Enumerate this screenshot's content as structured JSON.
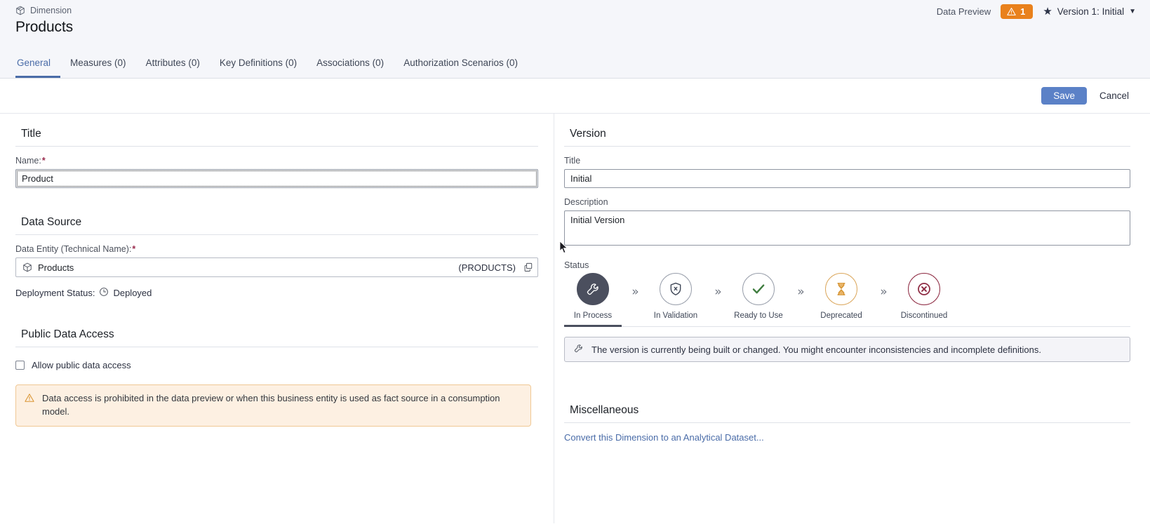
{
  "header": {
    "breadcrumb": "Dimension",
    "title": "Products",
    "data_preview": "Data Preview",
    "warning_count": "1",
    "version_switch": "Version 1: Initial"
  },
  "tabs": [
    {
      "label": "General",
      "active": true
    },
    {
      "label": "Measures (0)",
      "active": false
    },
    {
      "label": "Attributes (0)",
      "active": false
    },
    {
      "label": "Key Definitions (0)",
      "active": false
    },
    {
      "label": "Associations (0)",
      "active": false
    },
    {
      "label": "Authorization Scenarios (0)",
      "active": false
    }
  ],
  "actions": {
    "save": "Save",
    "cancel": "Cancel"
  },
  "left": {
    "title_section": "Title",
    "name_label": "Name:",
    "name_value": "Product",
    "data_source_section": "Data Source",
    "data_entity_label": "Data Entity (Technical Name):",
    "data_entity_name": "Products",
    "data_entity_technical": "(PRODUCTS)",
    "deployment_status_label": "Deployment Status:",
    "deployment_status_value": "Deployed",
    "public_access_section": "Public Data Access",
    "allow_public_label": "Allow public data access",
    "public_warning": "Data access is prohibited in the data preview or when this business entity is used as fact source in a consumption model."
  },
  "right": {
    "version_section": "Version",
    "version_title_label": "Title",
    "version_title_value": "Initial",
    "version_desc_label": "Description",
    "version_desc_value": "Initial Version",
    "status_label": "Status",
    "steps": [
      {
        "label": "In Process",
        "icon": "wrench-icon",
        "state": "active"
      },
      {
        "label": "In Validation",
        "icon": "shield-x-icon",
        "state": "default"
      },
      {
        "label": "Ready to Use",
        "icon": "check-icon",
        "state": "default"
      },
      {
        "label": "Deprecated",
        "icon": "hourglass-icon",
        "state": "amber"
      },
      {
        "label": "Discontinued",
        "icon": "circle-x-icon",
        "state": "crimson"
      }
    ],
    "status_message": "The version is currently being built or changed. You might encounter inconsistencies and incomplete definitions.",
    "misc_section": "Miscellaneous",
    "convert_link": "Convert this Dimension to an Analytical Dataset..."
  },
  "colors": {
    "accent": "#4a6ca8",
    "primary_button": "#5b81c7",
    "warning": "#e9811c",
    "amber": "#dca960",
    "crimson": "#8e2b43",
    "success": "#3f7d3f",
    "active_step": "#4b4f5e"
  }
}
